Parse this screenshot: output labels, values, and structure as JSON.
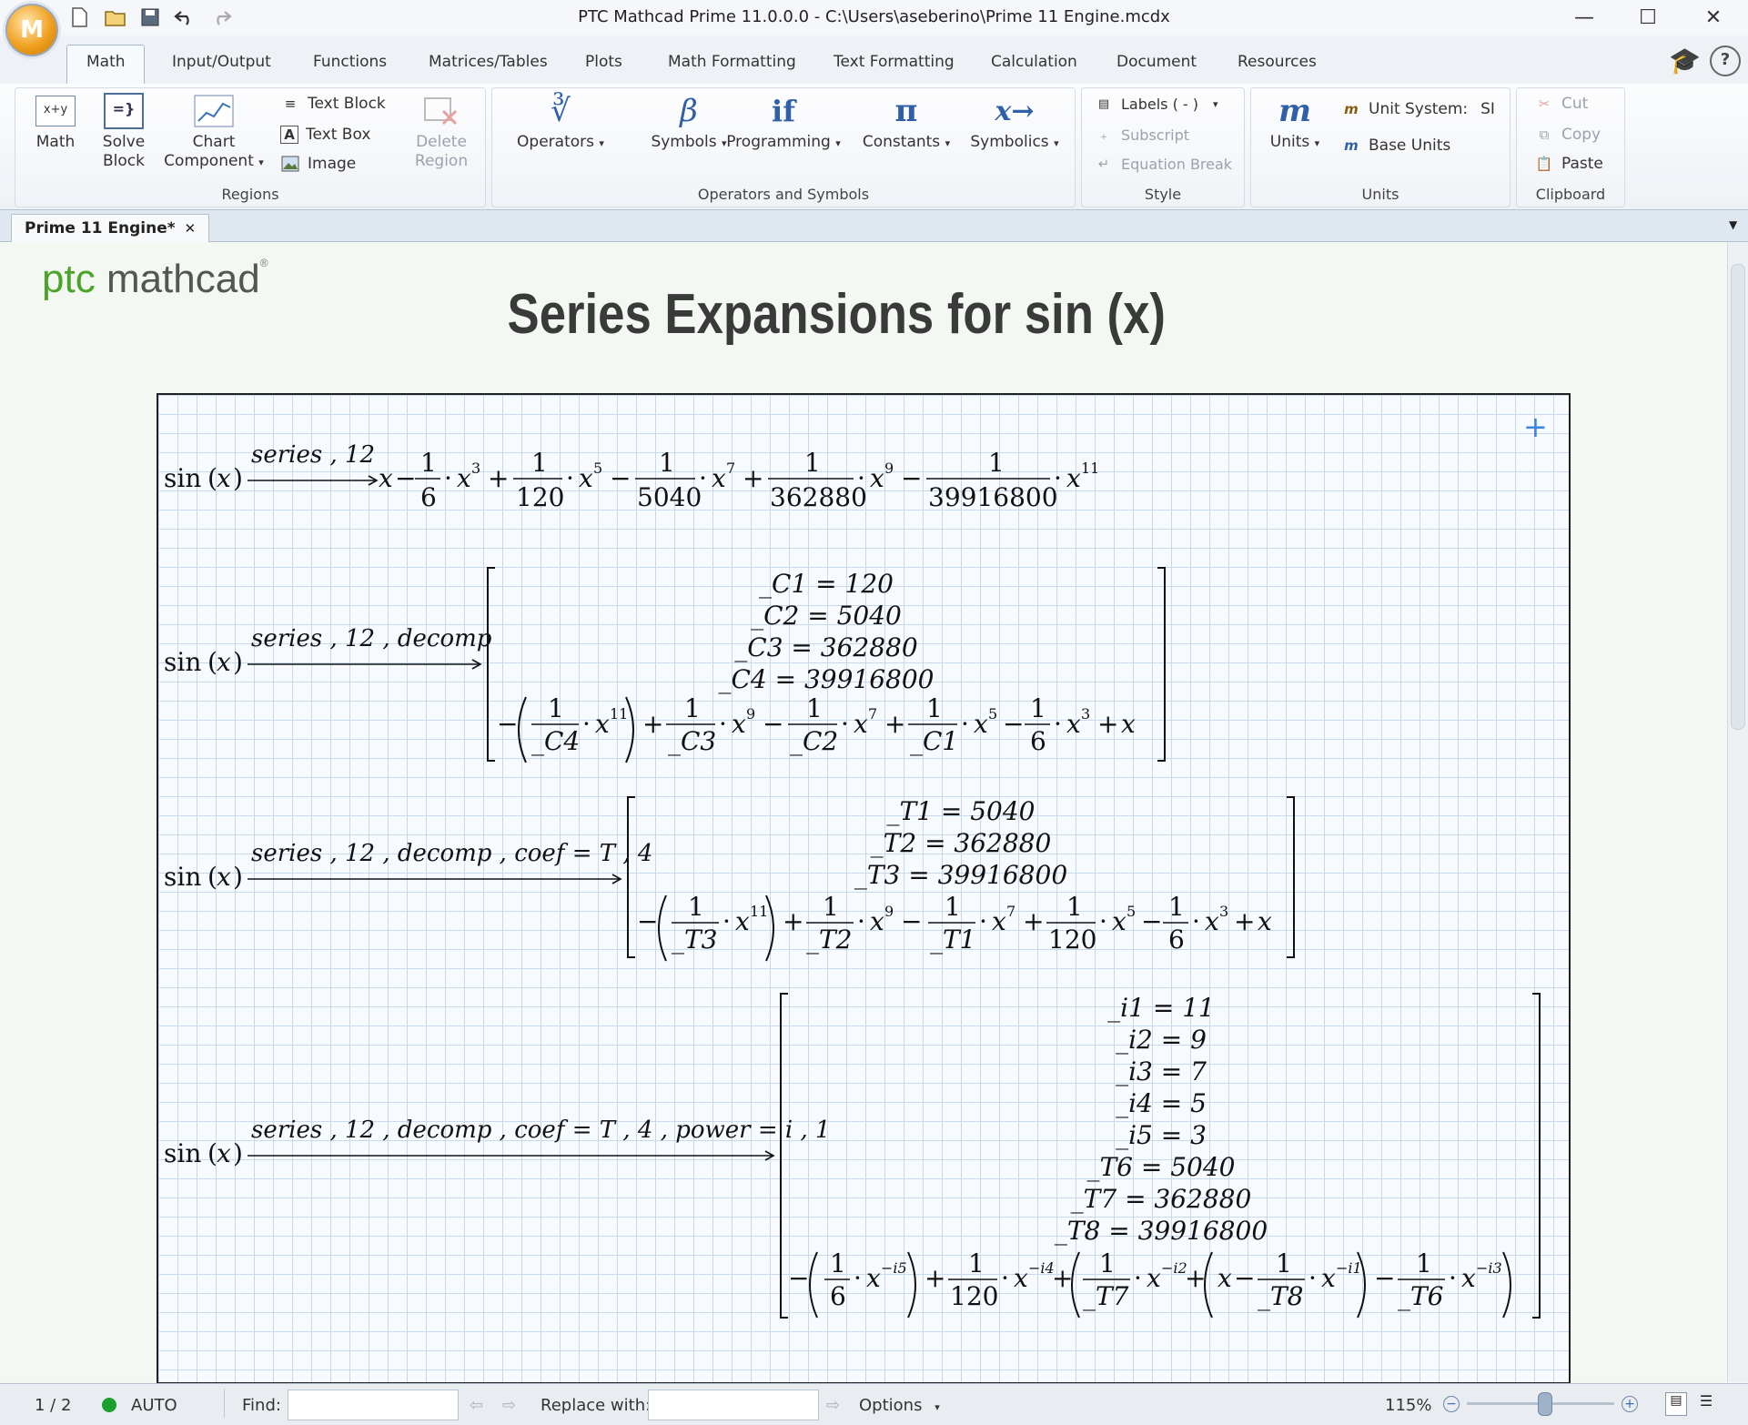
{
  "window": {
    "title": "PTC Mathcad Prime 11.0.0.0 - C:\\Users\\aseberino\\Prime 11 Engine.mcdx",
    "app_logo": "M",
    "quick_access": [
      "new-icon",
      "open-icon",
      "save-icon",
      "undo-icon",
      "redo-icon"
    ]
  },
  "ribbon_tabs": [
    "Math",
    "Input/Output",
    "Functions",
    "Matrices/Tables",
    "Plots",
    "Math Formatting",
    "Text Formatting",
    "Calculation",
    "Document",
    "Resources"
  ],
  "active_tab": "Math",
  "ribbon": {
    "regions": {
      "label": "Regions",
      "math": "Math",
      "math_icon_text": "x+y",
      "solve_block_1": "Solve",
      "solve_block_2": "Block",
      "chart_1": "Chart",
      "chart_2": "Component",
      "text_block": "Text Block",
      "text_box": "Text Box",
      "image": "Image",
      "delete_1": "Delete",
      "delete_2": "Region"
    },
    "operators": {
      "label": "Operators and Symbols",
      "operators": "Operators",
      "symbols": "Symbols",
      "programming": "Programming",
      "constants": "Constants",
      "symbolics": "Symbolics",
      "operators_glyph": "∛",
      "symbols_glyph": "β",
      "programming_glyph": "if",
      "constants_glyph": "π",
      "symbolics_glyph": "x→"
    },
    "style": {
      "label": "Style",
      "labels": "Labels  ( - )",
      "subscript": "Subscript",
      "equation_break": "Equation Break"
    },
    "units": {
      "label": "Units",
      "units": "Units",
      "units_glyph": "m",
      "unit_system": "Unit System:",
      "unit_system_value": "SI",
      "base_units": "Base Units"
    },
    "clipboard": {
      "label": "Clipboard",
      "cut": "Cut",
      "copy": "Copy",
      "paste": "Paste"
    }
  },
  "document_tab": "Prime 11 Engine*",
  "worksheet": {
    "logo_ptc": "ptc",
    "logo_mathcad": "mathcad",
    "logo_mark": "®",
    "heading": "Series Expansions for sin (x)",
    "lines": [
      {
        "lhs": "sin(x)",
        "keywords": "series , 12"
      },
      {
        "lhs": "sin(x)",
        "keywords": "series , 12 , decomp",
        "defs": [
          "_C1 = 120",
          "_C2 = 5040",
          "_C3 = 362880",
          "_C4 = 39916800"
        ]
      },
      {
        "lhs": "sin(x)",
        "keywords": "series , 12 , decomp , coef = T , 4",
        "defs": [
          "_T1 = 5040",
          "_T2 = 362880",
          "_T3 = 39916800"
        ]
      },
      {
        "lhs": "sin(x)",
        "keywords": "series , 12 , decomp , coef = T , 4 , power = i , 1",
        "defs": [
          "_i1 = 11",
          "_i2 = 9",
          "_i3 = 7",
          "_i4 = 5",
          "_i5 = 3",
          "_T6 = 5040",
          "_T7 = 362880",
          "_T8 = 39916800"
        ]
      }
    ]
  },
  "statusbar": {
    "page": "1 / 2",
    "calc_mode": "AUTO",
    "calc_color": "#1aa02e",
    "find_label": "Find:",
    "find_value": "",
    "replace_label": "Replace with:",
    "replace_value": "",
    "options": "Options",
    "zoom": "115%"
  }
}
